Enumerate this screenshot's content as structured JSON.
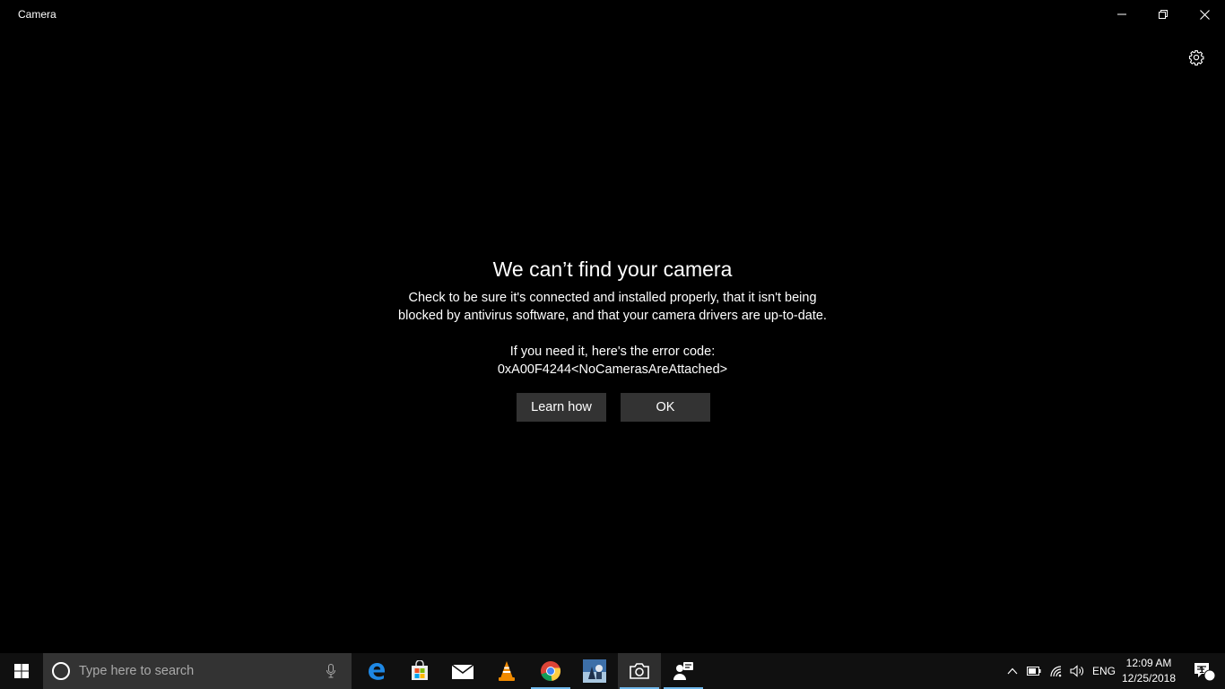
{
  "window": {
    "title": "Camera",
    "controls": {
      "minimize": "minimize-icon",
      "restore": "restore-icon",
      "close": "close-icon"
    }
  },
  "settings": {
    "icon": "gear-icon"
  },
  "dialog": {
    "title": "We can’t find your camera",
    "body_line1": "Check to be sure it's connected and installed properly, that it isn't being",
    "body_line2": "blocked by antivirus software, and that your camera drivers are up-to-date.",
    "error_intro": "If you need it, here's the error code:",
    "error_code": "0xA00F4244<NoCamerasAreAttached>",
    "learn_button": "Learn how",
    "ok_button": "OK"
  },
  "taskbar": {
    "search_placeholder": "Type here to search",
    "apps": [
      {
        "name": "Microsoft Edge",
        "icon": "edge-icon"
      },
      {
        "name": "Microsoft Store",
        "icon": "store-icon"
      },
      {
        "name": "Mail",
        "icon": "mail-icon"
      },
      {
        "name": "VLC media player",
        "icon": "vlc-icon"
      },
      {
        "name": "Google Chrome",
        "icon": "chrome-icon",
        "running": true
      },
      {
        "name": "Game",
        "icon": "game-icon"
      },
      {
        "name": "Camera",
        "icon": "camera-icon",
        "running": true,
        "active": true
      },
      {
        "name": "People",
        "icon": "people-icon",
        "running": true
      }
    ],
    "tray": {
      "language": "ENG",
      "time": "12:09 AM",
      "date": "12/25/2018",
      "notifications_count": "1"
    }
  },
  "colors": {
    "accent": "#6fb7ea",
    "button": "#333333",
    "taskbar": "#101010"
  }
}
